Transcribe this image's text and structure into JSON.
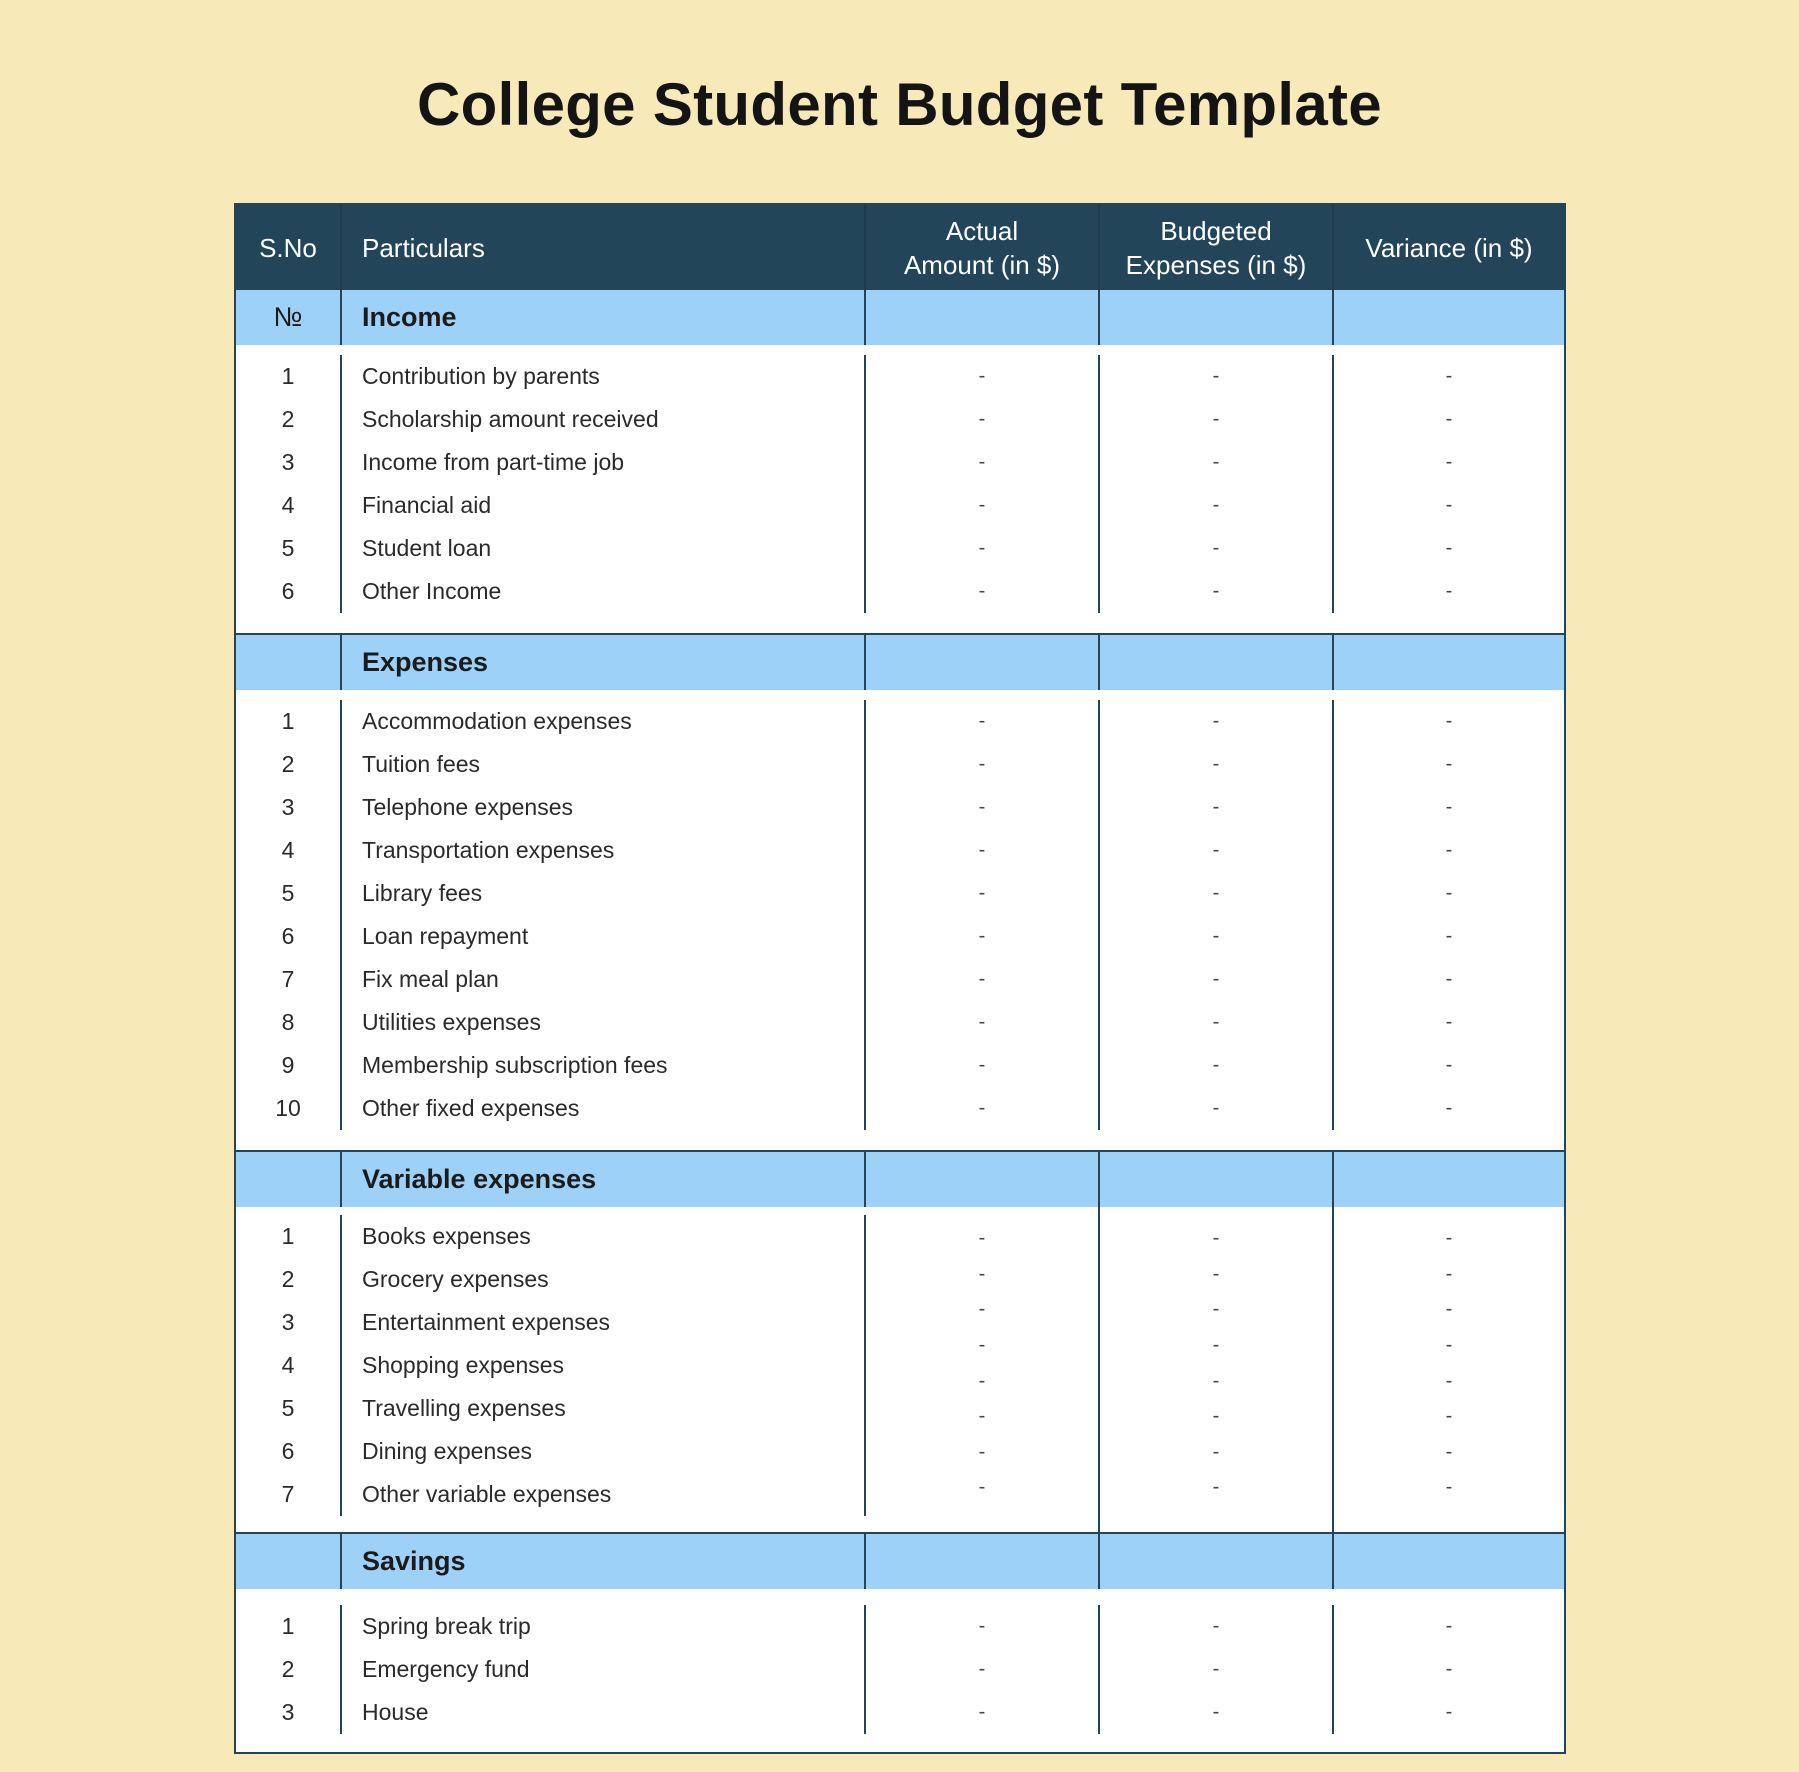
{
  "title": "College Student Budget Template",
  "colors": {
    "background": "#f8eab8",
    "header_bg": "#22455a",
    "section_bg": "#9dd1f8",
    "body_bg": "#ffffff",
    "border": "#22455a"
  },
  "table": {
    "columns": {
      "sno": "S.No",
      "particulars": "Particulars",
      "actual_line1": "Actual",
      "actual_line2": "Amount (in $)",
      "budgeted_line1": "Budgeted",
      "budgeted_line2": "Expenses (in $)",
      "variance": "Variance (in $)"
    },
    "sections": {
      "income": {
        "marker": "№",
        "label": "Income",
        "rows": [
          {
            "sno": "1",
            "particular": "Contribution by parents",
            "actual": "-",
            "budgeted": "-",
            "variance": "-"
          },
          {
            "sno": "2",
            "particular": "Scholarship amount received",
            "actual": "-",
            "budgeted": "-",
            "variance": "-"
          },
          {
            "sno": "3",
            "particular": "Income from part-time job",
            "actual": "-",
            "budgeted": "-",
            "variance": "-"
          },
          {
            "sno": "4",
            "particular": "Financial aid",
            "actual": "-",
            "budgeted": "-",
            "variance": "-"
          },
          {
            "sno": "5",
            "particular": "Student loan",
            "actual": "-",
            "budgeted": "-",
            "variance": "-"
          },
          {
            "sno": "6",
            "particular": "Other Income",
            "actual": "-",
            "budgeted": "-",
            "variance": "-"
          }
        ]
      },
      "expenses": {
        "label": "Expenses",
        "rows": [
          {
            "sno": "1",
            "particular": "Accommodation expenses",
            "actual": "-",
            "budgeted": "-",
            "variance": "-"
          },
          {
            "sno": "2",
            "particular": "Tuition fees",
            "actual": "-",
            "budgeted": "-",
            "variance": "-"
          },
          {
            "sno": "3",
            "particular": "Telephone expenses",
            "actual": "-",
            "budgeted": "-",
            "variance": "-"
          },
          {
            "sno": "4",
            "particular": "Transportation expenses",
            "actual": "-",
            "budgeted": "-",
            "variance": "-"
          },
          {
            "sno": "5",
            "particular": "Library fees",
            "actual": "-",
            "budgeted": "-",
            "variance": "-"
          },
          {
            "sno": "6",
            "particular": "Loan repayment",
            "actual": "-",
            "budgeted": "-",
            "variance": "-"
          },
          {
            "sno": "7",
            "particular": "Fix meal plan",
            "actual": "-",
            "budgeted": "-",
            "variance": "-"
          },
          {
            "sno": "8",
            "particular": "Utilities expenses",
            "actual": "-",
            "budgeted": "-",
            "variance": "-"
          },
          {
            "sno": "9",
            "particular": "Membership subscription fees",
            "actual": "-",
            "budgeted": "-",
            "variance": "-"
          },
          {
            "sno": "10",
            "particular": "Other fixed expenses",
            "actual": "-",
            "budgeted": "-",
            "variance": "-"
          }
        ]
      },
      "variable": {
        "label": "Variable expenses",
        "rows": [
          {
            "sno": "1",
            "particular": "Books expenses"
          },
          {
            "sno": "2",
            "particular": "Grocery expenses"
          },
          {
            "sno": "3",
            "particular": "Entertainment expenses"
          },
          {
            "sno": "4",
            "particular": "Shopping expenses"
          },
          {
            "sno": "5",
            "particular": "Travelling expenses"
          },
          {
            "sno": "6",
            "particular": "Dining expenses"
          },
          {
            "sno": "7",
            "particular": "Other variable expenses"
          }
        ],
        "actual": [
          "-",
          "-",
          "-",
          "-",
          "-",
          "-",
          "-",
          "-"
        ],
        "budgeted": [
          "-",
          "-",
          "-",
          "-",
          "-",
          "-",
          "-",
          "-"
        ],
        "variance": [
          "-",
          "-",
          "-",
          "-",
          "-",
          "-",
          "-",
          "-"
        ]
      },
      "savings": {
        "label": "Savings",
        "rows": [
          {
            "sno": "1",
            "particular": "Spring break trip",
            "actual": "-",
            "budgeted": "-",
            "variance": "-"
          },
          {
            "sno": "2",
            "particular": "Emergency fund",
            "actual": "-",
            "budgeted": "-",
            "variance": "-"
          },
          {
            "sno": "3",
            "particular": "House",
            "actual": "-",
            "budgeted": "-",
            "variance": "-"
          }
        ]
      }
    }
  }
}
